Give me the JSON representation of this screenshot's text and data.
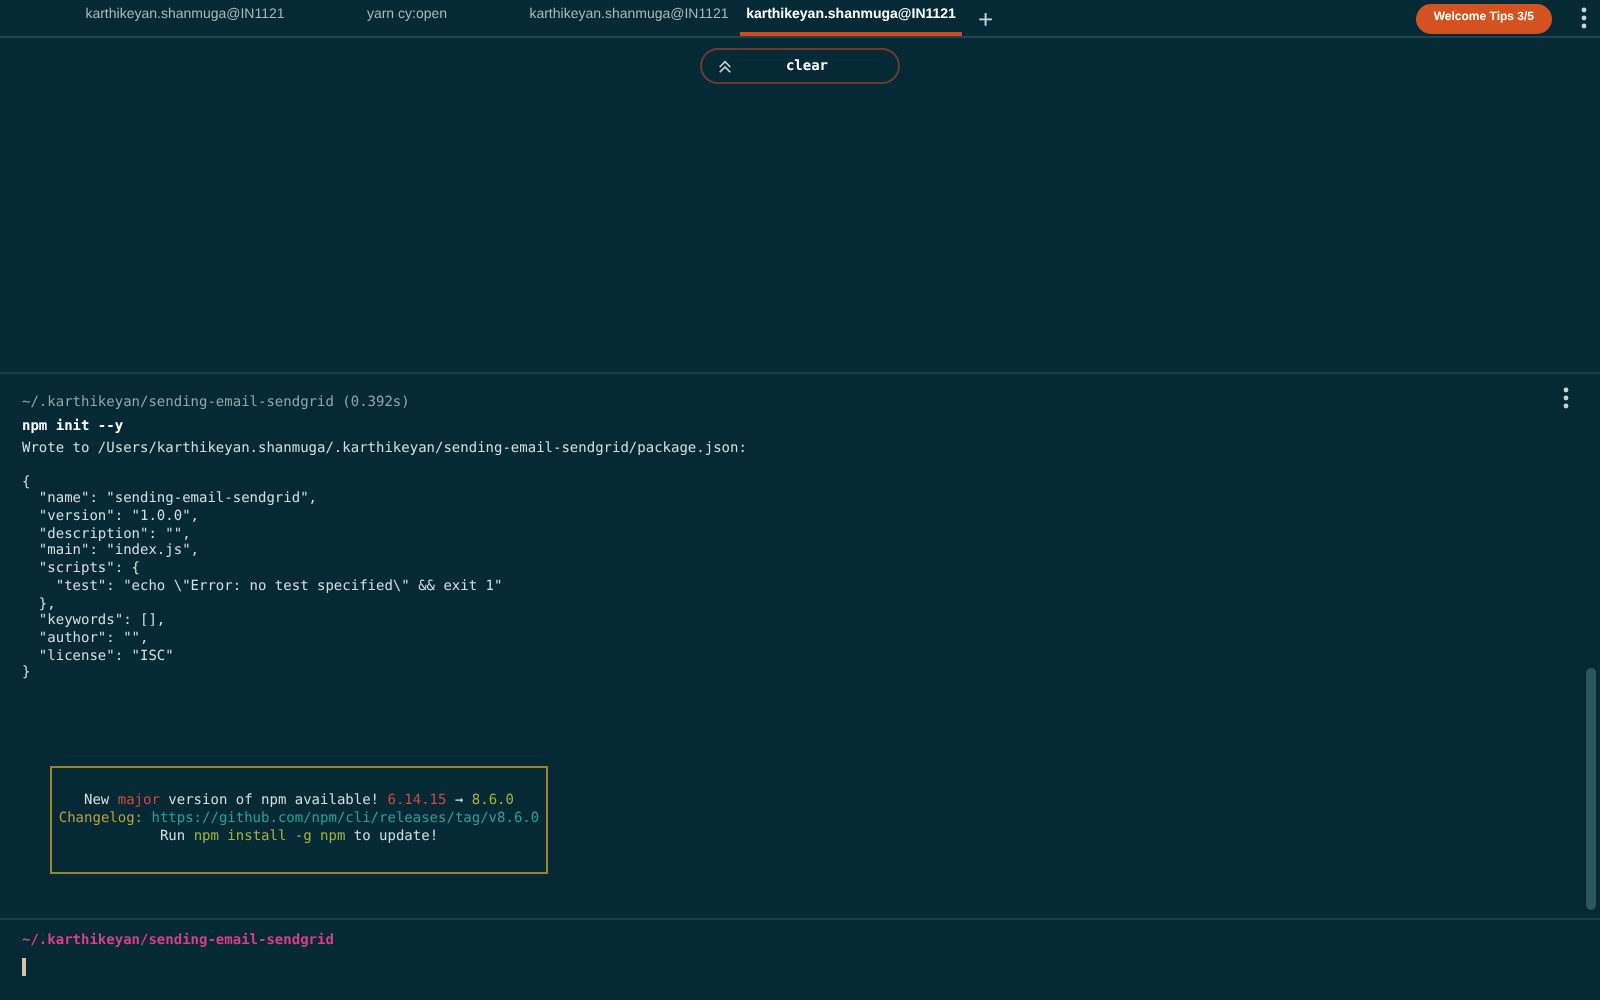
{
  "tabs": [
    {
      "label": "karthikeyan.shanmuga@IN1121",
      "selected": false
    },
    {
      "label": "yarn cy:open",
      "selected": false
    },
    {
      "label": "karthikeyan.shanmuga@IN1121",
      "selected": false
    },
    {
      "label": "karthikeyan.shanmuga@IN1121",
      "selected": true
    }
  ],
  "new_tab": "+",
  "tips_button": "Welcome Tips 3/5",
  "command_pill": {
    "label": "clear"
  },
  "block": {
    "path": "~/.karthikeyan/sending-email-sendgrid (0.392s)",
    "command": "npm init --y",
    "output": [
      "Wrote to /Users/karthikeyan.shanmuga/.karthikeyan/sending-email-sendgrid/package.json:",
      "{",
      "  \"name\": \"sending-email-sendgrid\",",
      "  \"version\": \"1.0.0\",",
      "  \"description\": \"\",",
      "  \"main\": \"index.js\",",
      "  \"scripts\": {",
      "    \"test\": \"echo \\\"Error: no test specified\\\" && exit 1\"",
      "  },",
      "  \"keywords\": [],",
      "  \"author\": \"\",",
      "  \"license\": \"ISC\"",
      "}"
    ],
    "notice": [
      [
        {
          "text": "New ",
          "kind": "plain"
        },
        {
          "text": "major",
          "kind": "red"
        },
        {
          "text": " version of npm available! ",
          "kind": "plain"
        },
        {
          "text": "6.14.15",
          "kind": "red"
        },
        {
          "text": " → ",
          "kind": "plain"
        },
        {
          "text": "8.6.0",
          "kind": "green"
        }
      ],
      [
        {
          "text": "Changelog: ",
          "kind": "yellow"
        },
        {
          "text": "https://github.com/npm/cli/releases/tag/v8.6.0",
          "kind": "cyan"
        }
      ],
      [
        {
          "text": "Run ",
          "kind": "plain"
        },
        {
          "text": "npm install -g npm",
          "kind": "green"
        },
        {
          "text": " to update!",
          "kind": "plain"
        }
      ]
    ]
  },
  "prompt": "~/.karthikeyan/sending-email-sendgrid"
}
